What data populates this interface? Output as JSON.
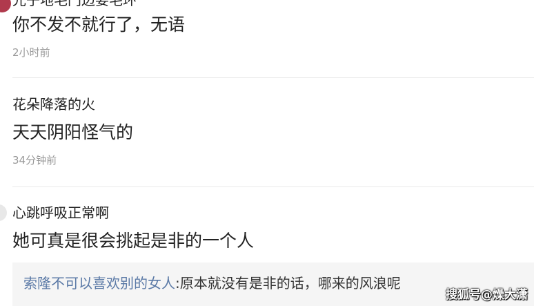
{
  "comments": [
    {
      "username_cut": "光子地毛门边要毛环",
      "content": "你不发不就行了，无语",
      "time": "2小时前"
    },
    {
      "username": "花朵降落的火",
      "content": "天天阴阳怪气的",
      "time": "34分钟前"
    },
    {
      "username": "心跳呼吸正常啊",
      "content": "她可真是很会挑起是非的一个人",
      "reply": {
        "user": "索隆不可以喜欢别的女人",
        "separator": ":",
        "text": "原本就没有是非的话，哪来的风浪呢"
      }
    }
  ],
  "watermark": "搜狐号@燥大潇",
  "colors": {
    "avatar_red": "#b03a4d",
    "reply_user": "#5a79a6",
    "time_gray": "#999999",
    "reply_bg": "#f5f5f5"
  }
}
